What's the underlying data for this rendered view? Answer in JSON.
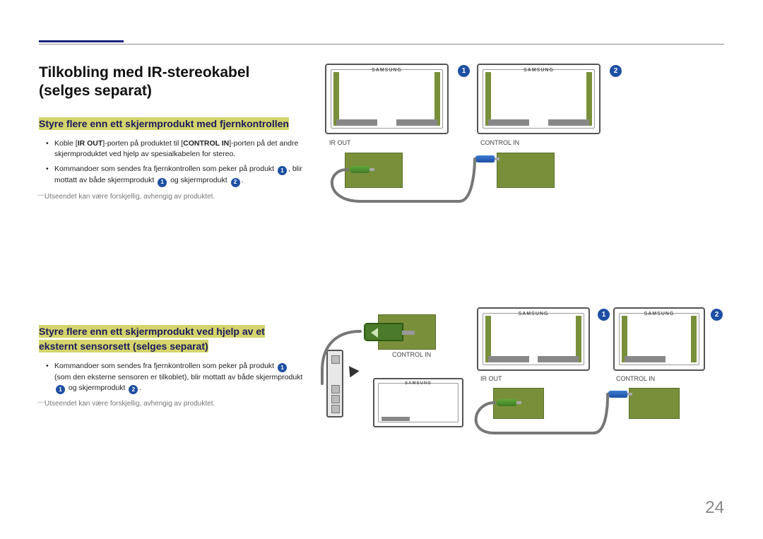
{
  "page_number": "24",
  "brand": "SAMSUNG",
  "title": "Tilkobling med IR-stereokabel (selges separat)",
  "section1": {
    "heading": "Styre flere enn ett skjermprodukt med fjernkontrollen",
    "bullet1_a": "Koble [",
    "bullet1_b": "IR OUT",
    "bullet1_c": "]-porten på produktet til [",
    "bullet1_d": "CONTROL IN",
    "bullet1_e": "]-porten på det andre skjermproduktet ved hjelp av spesialkabelen for stereo.",
    "bullet2_a": "Kommandoer som sendes fra fjernkontrollen som peker på produkt ",
    "bullet2_b": ", blir mottatt av både skjermprodukt ",
    "bullet2_c": " og skjermprodukt ",
    "bullet2_d": ".",
    "note": "Utseendet kan være forskjellig, avhengig av produktet."
  },
  "section2": {
    "heading": "Styre flere enn ett skjermprodukt ved hjelp av et eksternt sensorsett (selges separat)",
    "bullet1_a": "Kommandoer som sendes fra fjernkontrollen som peker på produkt ",
    "bullet1_b": "(som den eksterne sensoren er tilkoblet), blir mottatt av både skjermprodukt ",
    "bullet1_c": " og skjermprodukt ",
    "bullet1_d": ".",
    "note": "Utseendet kan være forskjellig, avhengig av produktet."
  },
  "labels": {
    "ir_out": "IR OUT",
    "control_in": "CONTROL IN"
  },
  "badges": {
    "one": "1",
    "two": "2"
  }
}
